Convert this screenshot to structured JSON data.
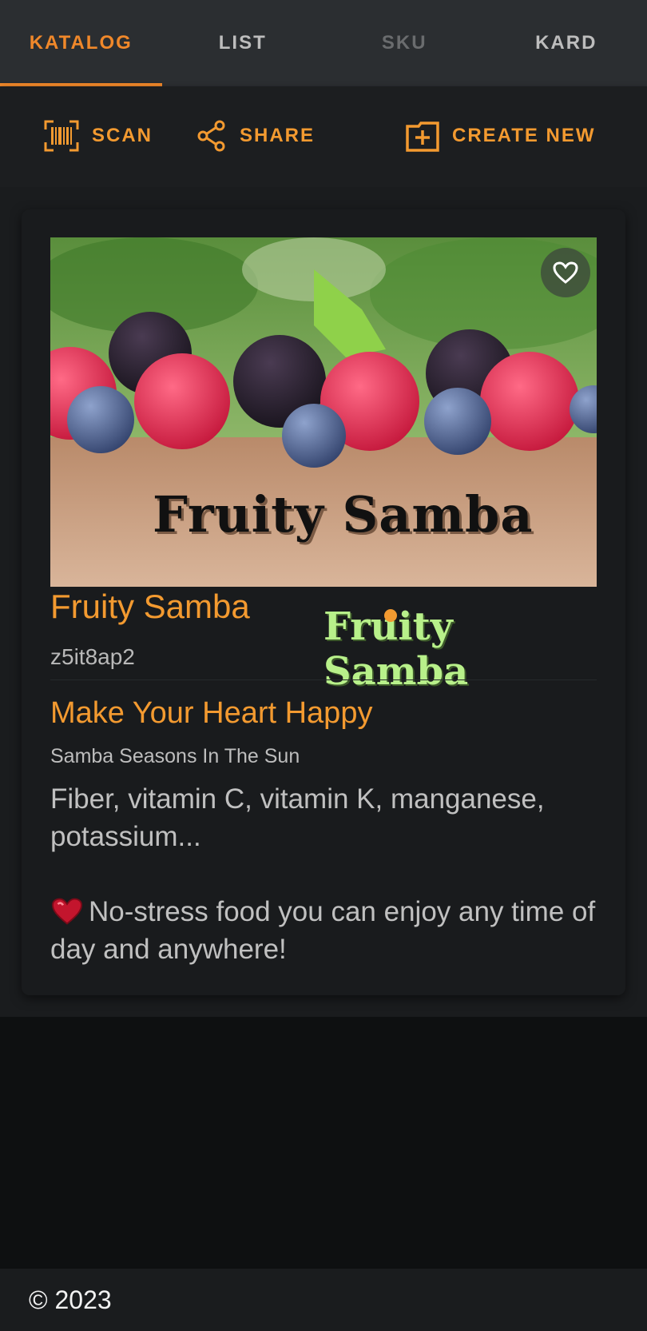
{
  "tabs": [
    {
      "label": "KATALOG",
      "state": "active"
    },
    {
      "label": "LIST",
      "state": "normal"
    },
    {
      "label": "SKU",
      "state": "disabled"
    },
    {
      "label": "KARD",
      "state": "normal"
    }
  ],
  "actions": {
    "scan_label": "SCAN",
    "share_label": "SHARE",
    "create_label": "CREATE NEW"
  },
  "product": {
    "name": "Fruity Samba",
    "code": "z5it8ap2",
    "logo_text": "Fruity Samba",
    "headline": "Make Your Heart Happy",
    "tagline": "Samba Seasons In The Sun",
    "description": "Fiber, vitamin C, vitamin K, manganese, potassium...",
    "note": "No-stress food you can enjoy any time of day and anywhere!"
  },
  "footer": {
    "copyright": "© 2023"
  },
  "colors": {
    "accent": "#f39a30",
    "tab_active": "#f0882a",
    "background": "#0e1011"
  }
}
